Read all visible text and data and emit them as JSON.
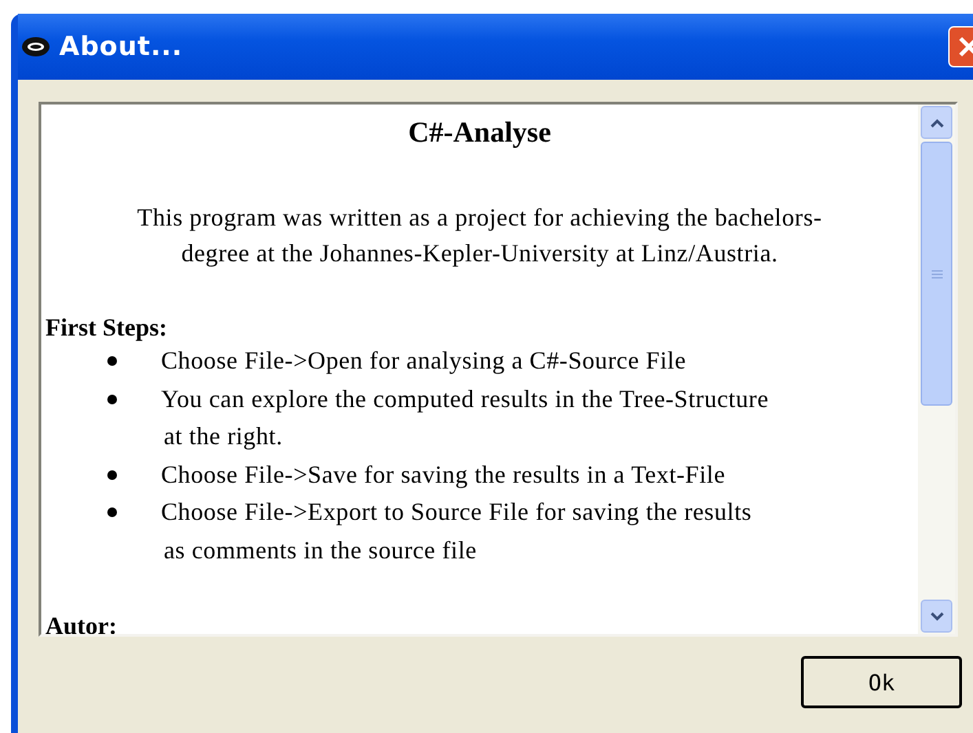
{
  "window": {
    "title": "About..."
  },
  "content": {
    "heading": "C#-Analyse",
    "intro": [
      "This program was written as a project for achieving the bachelors-",
      "degree at the Johannes-Kepler-University at Linz/Austria."
    ],
    "sections": [
      {
        "title": "First Steps:",
        "items": [
          {
            "lines": [
              "Choose File->Open for analysing a C#-Source File"
            ]
          },
          {
            "lines": [
              "You can explore the computed results in the Tree-Structure",
              "at the right."
            ]
          },
          {
            "lines": [
              "Choose File->Save for saving the results in a Text-File"
            ]
          },
          {
            "lines": [
              "Choose File->Export to Source File for saving the results",
              "as comments in the source file"
            ]
          }
        ]
      },
      {
        "title": "Autor:"
      }
    ]
  },
  "buttons": [
    {
      "label": "Ok"
    }
  ]
}
